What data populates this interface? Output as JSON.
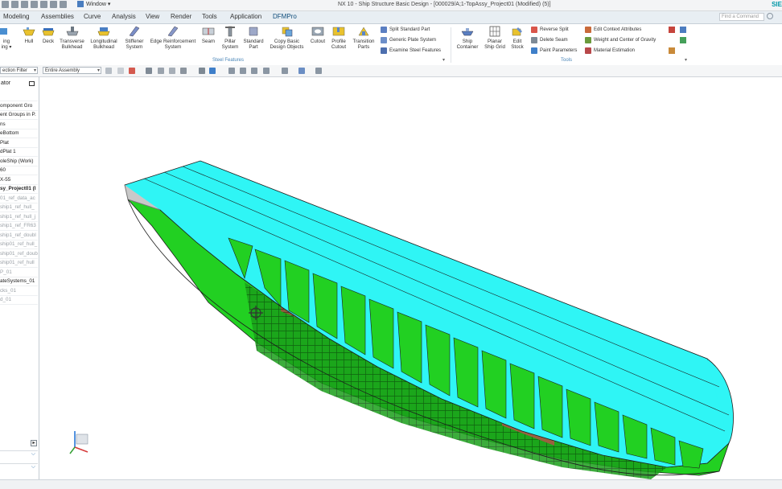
{
  "window": {
    "title": "NX 10 - Ship Structure Basic Design - [000029/A;1-TopAssy_Project01 (Modified)   (5)]",
    "window_menu": "Window",
    "brand": "SIE"
  },
  "menu": {
    "tabs": [
      "Modeling",
      "Assemblies",
      "Curve",
      "Analysis",
      "View",
      "Render",
      "Tools",
      "Application",
      "DFMPro"
    ],
    "find_placeholder": "Find a Command"
  },
  "ribbon": {
    "cut_left": [
      "ing",
      "ing ▾"
    ],
    "buttons": [
      {
        "label": "Hull",
        "icon": "hull-icon"
      },
      {
        "label": "Deck",
        "icon": "deck-icon"
      },
      {
        "label": "Transverse\nBulkhead",
        "icon": "transverse-bulkhead-icon"
      },
      {
        "label": "Longitudinal\nBulkhead",
        "icon": "longitudinal-bulkhead-icon"
      },
      {
        "label": "Stiffener\nSystem",
        "icon": "stiffener-system-icon"
      },
      {
        "label": "Edge Reinforcement\nSystem",
        "icon": "edge-reinforcement-icon"
      },
      {
        "label": "Seam",
        "icon": "seam-icon"
      },
      {
        "label": "Pillar\nSystem",
        "icon": "pillar-system-icon"
      },
      {
        "label": "Standard\nPart",
        "icon": "standard-part-icon"
      },
      {
        "label": "Copy Basic\nDesign Objects",
        "icon": "copy-objects-icon"
      },
      {
        "label": "Cutout",
        "icon": "cutout-icon"
      },
      {
        "label": "Profile\nCutout",
        "icon": "profile-cutout-icon"
      },
      {
        "label": "Transition\nParts",
        "icon": "transition-parts-icon"
      }
    ],
    "steel_small": [
      "Split Standard Part",
      "Generic Plate System",
      "Examine Steel Features"
    ],
    "steel_group_label": "Steel Features",
    "tool_buttons": [
      {
        "label": "Ship\nContainer",
        "icon": "ship-container-icon"
      },
      {
        "label": "Planar\nShip Grid",
        "icon": "ship-grid-icon"
      },
      {
        "label": "Edit\nStock",
        "icon": "edit-stock-icon"
      }
    ],
    "tools_small_a": [
      "Reverse Split",
      "Delete Seam",
      "Paint Parameters"
    ],
    "tools_small_b": [
      "Edit Context Attributes",
      "Weight and Center of Gravity",
      "Material Estimation"
    ],
    "tools_group_label": "Tools"
  },
  "toolbar": {
    "filter": "ection Filter",
    "scope": "Entire Assembly"
  },
  "navigator": {
    "title": "ator",
    "rows": [
      {
        "text": "",
        "style": ""
      },
      {
        "text": "omponent Gro",
        "style": ""
      },
      {
        "text": "ent Groups in P.",
        "style": ""
      },
      {
        "text": "ns",
        "style": ""
      },
      {
        "text": "eBottom",
        "style": ""
      },
      {
        "text": "Plat",
        "style": ""
      },
      {
        "text": "dPlat 1",
        "style": ""
      },
      {
        "text": "oleShip (Work)",
        "style": ""
      },
      {
        "text": "60",
        "style": ""
      },
      {
        "text": "X-55",
        "style": ""
      },
      {
        "text": "sy_Project01 (I",
        "style": "bold"
      },
      {
        "text": "01_ref_data_ac",
        "style": "dim"
      },
      {
        "text": "ship1_ref_hull_",
        "style": "dim"
      },
      {
        "text": "ship1_ref_hull_j",
        "style": "dim"
      },
      {
        "text": "ship1_ref_FR63",
        "style": "dim"
      },
      {
        "text": "ship1_ref_doubl",
        "style": "dim"
      },
      {
        "text": "ship01_ref_hull_",
        "style": "dim"
      },
      {
        "text": "ship01_ref_doub",
        "style": "dim"
      },
      {
        "text": "ship01_ref_hull",
        "style": "dim"
      },
      {
        "text": "P_01",
        "style": "dim"
      },
      {
        "text": "ateSystems_01",
        "style": ""
      },
      {
        "text": "cks_01",
        "style": "dim"
      },
      {
        "text": "d_01",
        "style": "dim"
      }
    ]
  },
  "colors": {
    "deck": "#2ff5f5",
    "shell": "#22d022",
    "outline": "#2a2a2a",
    "accent": "#0e6fb4"
  }
}
